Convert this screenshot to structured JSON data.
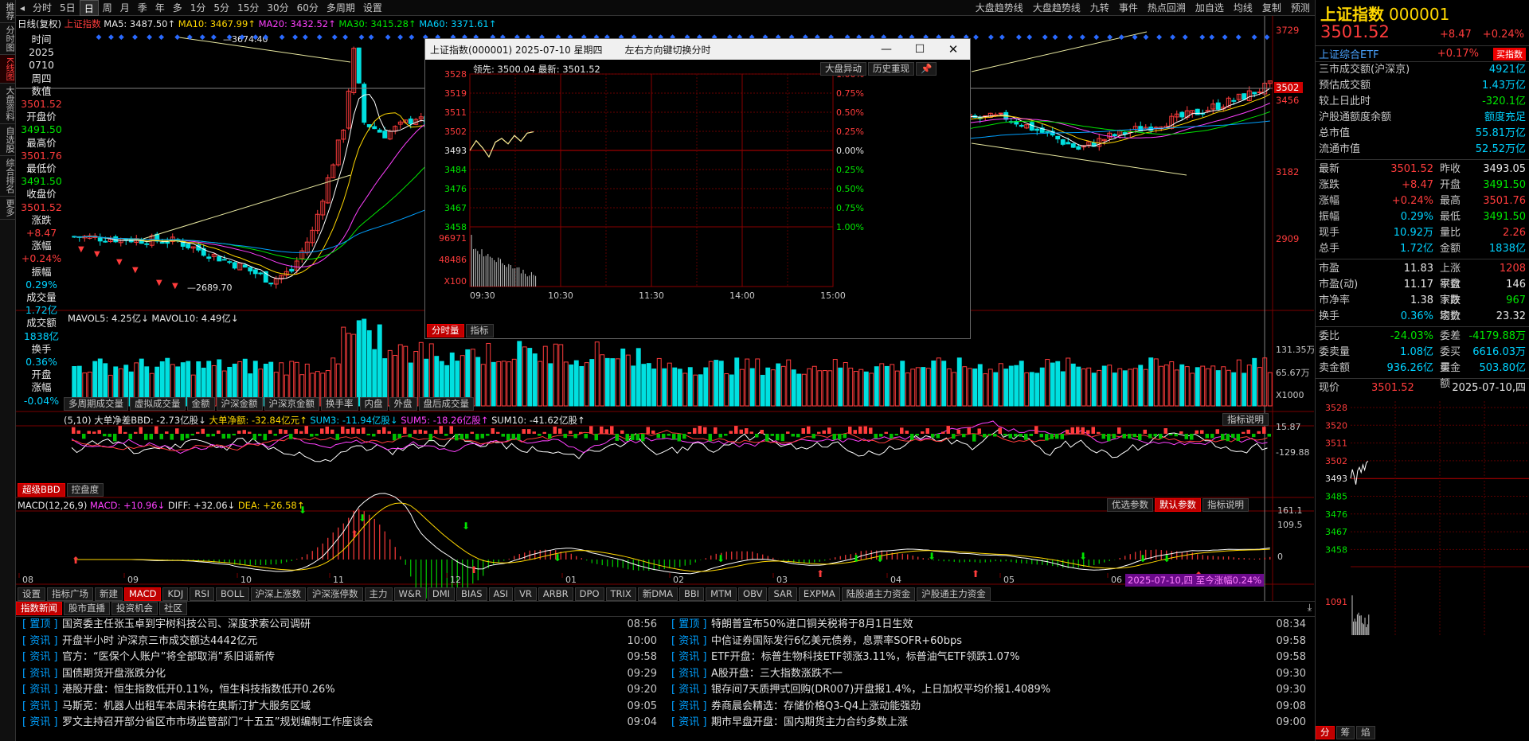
{
  "toolbar": {
    "buttons": [
      "分时",
      "5日",
      "日",
      "周",
      "月",
      "季",
      "年",
      "多",
      "1分",
      "5分",
      "15分",
      "30分",
      "60分",
      "多周期",
      "设置"
    ],
    "active": "日",
    "right_items": [
      "大盘趋势线",
      "大盘趋势线",
      "九转",
      "事件",
      "热点回溯",
      "加自选",
      "均线",
      "复制",
      "预测"
    ]
  },
  "left_sidebar": [
    "推荐",
    "分时图",
    "K线图",
    "大盘资料",
    "自选股",
    "综合排名",
    "更多"
  ],
  "left_sidebar_active": "K线图",
  "info_col": [
    {
      "t": "时间",
      "c": "wht"
    },
    {
      "t": "2025",
      "c": "wht"
    },
    {
      "t": "0710",
      "c": "wht"
    },
    {
      "t": "周四",
      "c": "wht"
    },
    {
      "t": "数值",
      "c": "wht"
    },
    {
      "t": "3501.52",
      "c": "red"
    },
    {
      "t": "开盘价",
      "c": "wht"
    },
    {
      "t": "3491.50",
      "c": "grn"
    },
    {
      "t": "最高价",
      "c": "wht"
    },
    {
      "t": "3501.76",
      "c": "red"
    },
    {
      "t": "最低价",
      "c": "wht"
    },
    {
      "t": "3491.50",
      "c": "grn"
    },
    {
      "t": "收盘价",
      "c": "wht"
    },
    {
      "t": "3501.52",
      "c": "red"
    },
    {
      "t": "涨跌",
      "c": "wht"
    },
    {
      "t": "+8.47",
      "c": "red"
    },
    {
      "t": "涨幅",
      "c": "wht"
    },
    {
      "t": "+0.24%",
      "c": "red"
    },
    {
      "t": "振幅",
      "c": "wht"
    },
    {
      "t": "0.29%",
      "c": "cyn"
    },
    {
      "t": "成交量",
      "c": "wht"
    },
    {
      "t": "1.72亿",
      "c": "cyn"
    },
    {
      "t": "成交额",
      "c": "wht"
    },
    {
      "t": "1838亿",
      "c": "cyn"
    },
    {
      "t": "换手",
      "c": "wht"
    },
    {
      "t": "0.36%",
      "c": "cyn"
    },
    {
      "t": "开盘",
      "c": "wht"
    },
    {
      "t": "涨幅",
      "c": "wht"
    },
    {
      "t": "-0.04%",
      "c": "cyn"
    }
  ],
  "header": {
    "title": "日线(复权)",
    "name": "上证指数",
    "ma5": "MA5: 3487.50↑",
    "ma10": "MA10: 3467.99↑",
    "ma20": "MA20: 3432.52↑",
    "ma30": "MA30: 3415.28↑",
    "ma60": "MA60: 3371.61↑"
  },
  "price_axis": [
    "3729",
    "3502",
    "3456",
    "3182",
    "2909"
  ],
  "price_labels": {
    "high": "3674.40",
    "low": "2689.70"
  },
  "vol_panel": {
    "mavol5": "MAVOL5: 4.25亿↓",
    "mavol10": "MAVOL10: 4.49亿↓",
    "axis": [
      "131.35万",
      "65.67万",
      "X1000"
    ],
    "tabs": [
      "多周期成交量",
      "虚拟成交量",
      "金额",
      "沪深金额",
      "沪深京金额",
      "换手率",
      "内盘",
      "外盘",
      "盘后成交量"
    ]
  },
  "bbd_panel": {
    "params": "(5,10)",
    "bbd": "大单净差BBD: -2.73亿股↓",
    "jine": "大单净额: -32.84亿元↑",
    "sum3": "SUM3: -11.94亿股↓",
    "sum5": "SUM5: -18.26亿股↑",
    "sum10": "SUM10: -41.62亿股↑",
    "help": "指标说明",
    "axis": [
      "15.87",
      "-129.88"
    ],
    "tabs": [
      "超级BBD",
      "控盘度"
    ]
  },
  "macd_panel": {
    "name": "MACD(12,26,9)",
    "macd": "MACD: +10.96↓",
    "diff": "DIFF: +32.06↓",
    "dea": "DEA: +26.58↑",
    "btns": [
      "优选参数",
      "默认参数",
      "指标说明"
    ],
    "axis": [
      "161.1",
      "109.5",
      "0"
    ]
  },
  "date_axis": [
    "08",
    "09",
    "10",
    "11",
    "12",
    "01",
    "02",
    "03",
    "04",
    "05",
    "06"
  ],
  "date_badge": "2025-07-10,四 至今涨幅0.24%",
  "ind_tabs": [
    "设置",
    "指标广场",
    "新建",
    "MACD",
    "KDJ",
    "RSI",
    "BOLL",
    "沪深上涨数",
    "沪深涨停数",
    "主力",
    "W&R",
    "DMI",
    "BIAS",
    "ASI",
    "VR",
    "ARBR",
    "DPO",
    "TRIX",
    "新DMA",
    "BBI",
    "MTM",
    "OBV",
    "SAR",
    "EXPMA",
    "陆股通主力资金",
    "沪股通主力资金"
  ],
  "ind_active": "MACD",
  "popup": {
    "title": "上证指数(000001) 2025-07-10 星期四",
    "hint": "左右方向键切换分时",
    "lead": "领先: 3500.04",
    "latest": "最新: 3501.52",
    "btn1": "大盘异动",
    "btn2": "历史重现",
    "yaxis": [
      "3528",
      "3519",
      "3511",
      "3502",
      "3493",
      "3484",
      "3476",
      "3467",
      "3458"
    ],
    "pct": [
      "1.00%",
      "0.75%",
      "0.50%",
      "0.25%",
      "0.00%",
      "0.25%",
      "0.50%",
      "0.75%",
      "1.00%"
    ],
    "vaxis": [
      "96971",
      "48486",
      "X100"
    ],
    "times": [
      "09:30",
      "10:30",
      "11:30",
      "14:00",
      "15:00"
    ],
    "tabs": [
      "分时量",
      "指标"
    ],
    "chart_data": {
      "type": "line",
      "x": [
        "09:30",
        "09:35",
        "09:40",
        "09:45",
        "09:50",
        "09:55",
        "10:00",
        "10:05",
        "10:10",
        "10:15",
        "10:20"
      ],
      "values": [
        3493.05,
        3497.5,
        3494.2,
        3490.0,
        3496.8,
        3498.5,
        3496.0,
        3499.8,
        3497.2,
        3500.9,
        3501.52
      ],
      "ylim": [
        3458,
        3528
      ]
    }
  },
  "right_panel": {
    "name": "上证指数",
    "code": "000001",
    "price": "3501.52",
    "chg": "+8.47",
    "pct": "+0.24%",
    "etf": "上证综合ETF",
    "etf_pct": "+0.17%",
    "etf_btn": "买指数",
    "rows1": [
      {
        "l": "三市成交额(沪深京)",
        "v": "4921亿",
        "c": "cyn"
      },
      {
        "l": "预估成交额",
        "v": "1.43万亿",
        "c": "cyn"
      },
      {
        "l": "较上日此时",
        "v": "-320.1亿",
        "c": "grn"
      },
      {
        "l": "沪股通额度余额",
        "v": "额度充足",
        "c": "cyn"
      },
      {
        "l": "总市值",
        "v": "55.81万亿",
        "c": "cyn"
      },
      {
        "l": "流通市值",
        "v": "52.52万亿",
        "c": "cyn"
      }
    ],
    "rows2": [
      {
        "l": "最新",
        "v": "3501.52",
        "c": "red",
        "l2": "昨收",
        "v2": "3493.05",
        "c2": "wht"
      },
      {
        "l": "涨跌",
        "v": "+8.47",
        "c": "red",
        "l2": "开盘",
        "v2": "3491.50",
        "c2": "grn"
      },
      {
        "l": "涨幅",
        "v": "+0.24%",
        "c": "red",
        "l2": "最高",
        "v2": "3501.76",
        "c2": "red"
      },
      {
        "l": "振幅",
        "v": "0.29%",
        "c": "cyn",
        "l2": "最低",
        "v2": "3491.50",
        "c2": "grn"
      },
      {
        "l": "现手",
        "v": "10.92万",
        "c": "cyn",
        "l2": "量比",
        "v2": "2.26",
        "c2": "red"
      },
      {
        "l": "总手",
        "v": "1.72亿",
        "c": "cyn",
        "l2": "金额",
        "v2": "1838亿",
        "c2": "cyn"
      }
    ],
    "rows3": [
      {
        "l": "市盈",
        "v": "11.83",
        "c": "wht",
        "l2": "上涨家数",
        "v2": "1208",
        "c2": "red"
      },
      {
        "l": "市盈(动)",
        "v": "11.17",
        "c": "wht",
        "l2": "平盘家数",
        "v2": "146",
        "c2": "wht"
      },
      {
        "l": "市净率",
        "v": "1.38",
        "c": "wht",
        "l2": "下跌家数",
        "v2": "967",
        "c2": "grn"
      },
      {
        "l": "换手",
        "v": "0.36%",
        "c": "cyn",
        "l2": "均价",
        "v2": "23.32",
        "c2": "wht"
      }
    ],
    "rows4": [
      {
        "l": "委比",
        "v": "-24.03%",
        "c": "grn",
        "l2": "委差",
        "v2": "-4179.88万",
        "c2": "grn"
      },
      {
        "l": "委卖量",
        "v": "1.08亿",
        "c": "cyn",
        "l2": "委买量",
        "v2": "6616.03万",
        "c2": "cyn"
      },
      {
        "l": "卖金额",
        "v": "936.26亿",
        "c": "cyn",
        "l2": "买金额",
        "v2": "503.80亿",
        "c2": "cyn"
      }
    ],
    "mini": {
      "label": "现价",
      "price": "3501.52",
      "date": "2025-07-10,四",
      "axis": [
        "3528",
        "3520",
        "3511",
        "3502",
        "3493",
        "3485",
        "3476",
        "3467",
        "3458",
        "1091"
      ],
      "tabs": [
        "分",
        "筹",
        "焰"
      ]
    }
  },
  "news": {
    "tabs": [
      "指数新闻",
      "股市直播",
      "投资机会",
      "社区"
    ],
    "left": [
      {
        "tag": "置顶",
        "text": "国资委主任张玉卓到宇树科技公司、深度求索公司调研",
        "time": "08:56"
      },
      {
        "tag": "资讯",
        "text": "开盘半小时 沪深京三市成交额达4442亿元",
        "time": "10:00"
      },
      {
        "tag": "资讯",
        "text": "官方：“医保个人账户”将全部取消”系旧谣新传",
        "time": "09:58"
      },
      {
        "tag": "资讯",
        "text": "国债期货开盘涨跌分化",
        "time": "09:29"
      },
      {
        "tag": "资讯",
        "text": "港股开盘：恒生指数低开0.11%，恒生科技指数低开0.26%",
        "time": "09:20"
      },
      {
        "tag": "资讯",
        "text": "马斯克：机器人出租车本周末将在奥斯汀扩大服务区域",
        "time": "09:05"
      },
      {
        "tag": "资讯",
        "text": "罗文主持召开部分省区市市场监管部门“十五五”规划编制工作座谈会",
        "time": "09:04"
      }
    ],
    "right": [
      {
        "tag": "置顶",
        "text": "特朗普宣布50%进口铜关税将于8月1日生效",
        "time": "08:34"
      },
      {
        "tag": "资讯",
        "text": "中信证券国际发行6亿美元债券，息票率SOFR+60bps",
        "time": "09:58"
      },
      {
        "tag": "资讯",
        "text": "ETF开盘：标普生物科技ETF领涨3.11%，标普油气ETF领跌1.07%",
        "time": "09:58"
      },
      {
        "tag": "资讯",
        "text": "A股开盘：三大指数涨跌不一",
        "time": "09:30"
      },
      {
        "tag": "资讯",
        "text": "银存间7天质押式回购(DR007)开盘报1.4%，上日加权平均价报1.4089%",
        "time": "09:30"
      },
      {
        "tag": "资讯",
        "text": "券商晨会精选：存储价格Q3-Q4上涨动能强劲",
        "time": "09:08"
      },
      {
        "tag": "资讯",
        "text": "期市早盘开盘：国内期货主力合约多数上涨",
        "time": "09:00"
      }
    ]
  }
}
